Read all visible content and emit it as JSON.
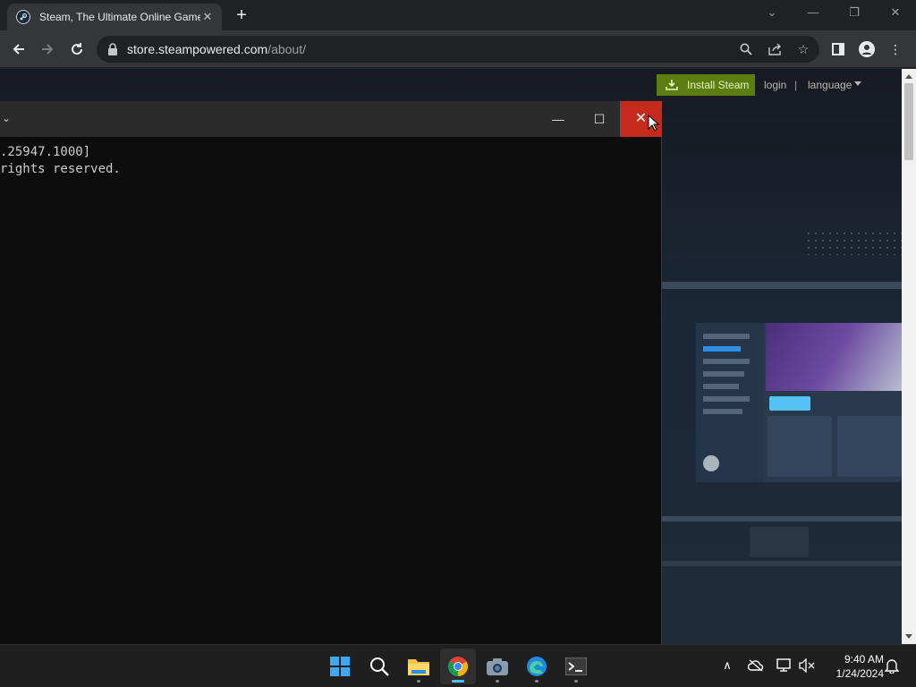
{
  "browser": {
    "tab_title": "Steam, The Ultimate Online Game Platform",
    "url_host": "store.steampowered.com",
    "url_path": "/about/",
    "new_tab_label": "+",
    "icons": [
      "back-icon",
      "forward-icon",
      "reload-icon",
      "lock-icon",
      "search-icon",
      "share-icon",
      "star-icon",
      "side-panel-icon",
      "profile-icon",
      "menu-icon"
    ]
  },
  "steam": {
    "install_label": "Install Steam",
    "login_label": "login",
    "separator": "|",
    "language_label": "language"
  },
  "console": {
    "line1": ".25947.1000]",
    "line2": "rights reserved."
  },
  "taskbar": {
    "apps": [
      "start",
      "search",
      "file-explorer",
      "chrome",
      "camera",
      "edge",
      "terminal"
    ],
    "active_app": "chrome",
    "time": "9:40 AM",
    "date": "1/24/2024"
  },
  "colors": {
    "steam_install_green": "#5c7e10",
    "close_hover_red": "#c42b1c",
    "taskbar_active_indicator": "#4cc2ff"
  }
}
